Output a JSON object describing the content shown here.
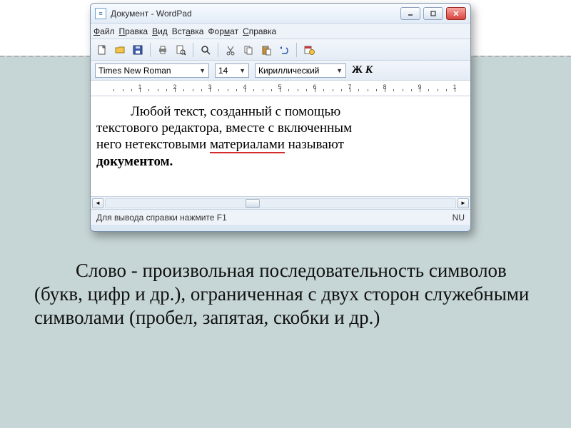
{
  "window": {
    "title": "Документ - WordPad",
    "menu": {
      "file": "Файл",
      "edit": "Правка",
      "view": "Вид",
      "insert": "Вставка",
      "format": "Формат",
      "help": "Справка"
    },
    "toolbar_icons": [
      "new",
      "open",
      "save",
      "print",
      "preview",
      "find",
      "cut",
      "copy",
      "paste",
      "undo",
      "datetime"
    ],
    "format": {
      "font": "Times New Roman",
      "size": "14",
      "script": "Кириллический",
      "bold": "Ж",
      "italic": "К"
    },
    "ruler_numbers": [
      "1",
      "2",
      "3",
      "4",
      "5",
      "6",
      "7",
      "8",
      "9",
      "1"
    ],
    "document": {
      "line1": "Любой текст, созданный с помощью",
      "line2a": "текстового редактора, вместе с включенным",
      "line3a": "него нетекстовыми ",
      "line3b": "материалами",
      "line3c": " называют",
      "line4": "документом."
    },
    "status": {
      "hint": "Для вывода справки нажмите F1",
      "indicator": "NU"
    }
  },
  "caption": {
    "text": "Слово - произвольная последовательность символов (букв, цифр и др.), ограниченная с двух сторон служебными символами (пробел, запятая, скобки и др.)"
  }
}
